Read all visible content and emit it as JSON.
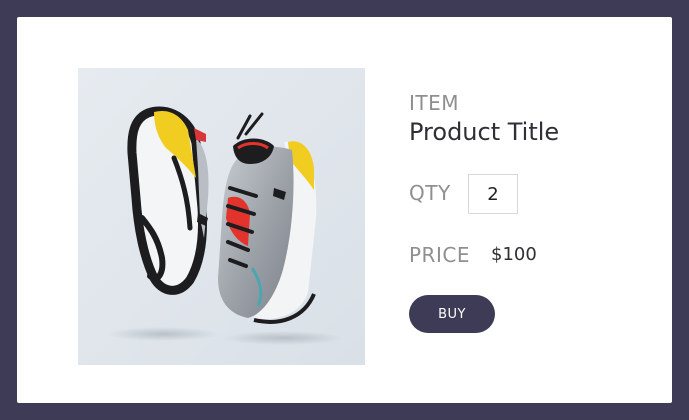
{
  "product": {
    "item_label": "ITEM",
    "title": "Product Title",
    "qty_label": "QTY",
    "qty_value": "2",
    "price_label": "PRICE",
    "price_value": "$100",
    "buy_label": "BUY",
    "image_icon": "sneakers-photo"
  },
  "colors": {
    "frame": "#3d3b55",
    "button": "#3d3b55",
    "label_gray": "#8f8f8f",
    "accent_yellow": "#f1cd22",
    "accent_red": "#e2332c"
  }
}
